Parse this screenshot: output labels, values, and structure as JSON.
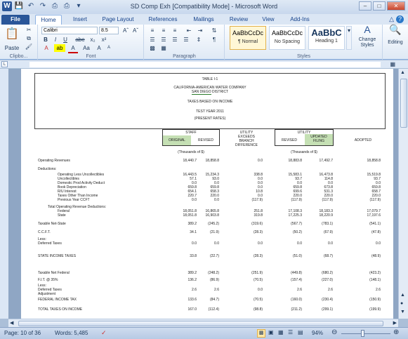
{
  "titlebar": {
    "title": "SD Comp Exh [Compatibility Mode] - Microsoft Word",
    "icons": [
      "word-logo-icon",
      "save-icon",
      "undo-icon",
      "redo-icon",
      "print-icon",
      "quick-print-icon",
      "customize-icon"
    ]
  },
  "tabs": [
    "File",
    "Home",
    "Insert",
    "Page Layout",
    "References",
    "Mailings",
    "Review",
    "View",
    "Add-Ins"
  ],
  "ribbon": {
    "clipboard": {
      "paste": "Paste",
      "label": "Clipbo..."
    },
    "font": {
      "name": "Calibri",
      "size": "8.5",
      "label": "Font",
      "buttons": [
        "B",
        "I",
        "U",
        "abe",
        "x₂",
        "x²",
        "A",
        "ab",
        "A",
        "Aa",
        "A",
        "A"
      ]
    },
    "paragraph": {
      "label": "Paragraph"
    },
    "styles": {
      "label": "Styles",
      "items": [
        {
          "preview": "AaBbCcDc",
          "name": "¶ Normal"
        },
        {
          "preview": "AaBbCcDc",
          "name": "No Spacing"
        },
        {
          "preview": "AaBbC",
          "name": "Heading 1"
        }
      ],
      "change": "Change Styles",
      "editing": "Editing"
    }
  },
  "doc": {
    "title1": "TABLE I-1",
    "title2": "CALIFORNIA-AMERICAN WATER COMPANY",
    "title2b": "SAN DIEGO",
    "title2c": " DISTRICT",
    "title3": "TAXES BASED ON INCOME",
    "title4": "TEST YEAR 2011",
    "title5": "(PRESENT RATES)",
    "hdr_staff": "STAFF",
    "hdr_original": "ORIGINAL",
    "hdr_revised": "REVISED",
    "hdr_utility_exceeds": "UTILITY\nEXCEEDS\nBRANCH\nDIFFERENCE",
    "hdr_utility": "UTILITY",
    "hdr_updated": "UPDATED\nFILING",
    "hdr_revised2": "REVISED",
    "hdr_adopted": "ADOPTED",
    "thousands1": "(Thousands of $)",
    "thousands2": "(Thousands of $)",
    "rows": [
      {
        "label": "Operating Revenues",
        "vals": [
          "18,440.7",
          "18,858.8",
          "0.0",
          "18,883.8",
          "17,492.7",
          "18,858.8"
        ],
        "indent": 0
      },
      {
        "label": "Deductions:",
        "vals": [],
        "indent": 0
      },
      {
        "label": "Operating Less Uncollectibles",
        "vals": [
          "16,443.5",
          "15,234.3",
          "338.8",
          "15,583.1",
          "16,473.8",
          "15,519.8"
        ],
        "indent": 2
      },
      {
        "label": "Uncollectibles",
        "vals": [
          "57.1",
          "93.0",
          "0.0",
          "93.7",
          "114.8",
          "93.7"
        ],
        "indent": 2
      },
      {
        "label": "Domestic Prod Activity Deduct",
        "vals": [
          "0.0",
          "0.0",
          "0.0",
          "0.0",
          "0.0",
          "0.0"
        ],
        "indent": 2
      },
      {
        "label": "Book Depreciation",
        "vals": [
          "659.8",
          "659.8",
          "0.0",
          "659.8",
          "673.8",
          "659.8"
        ],
        "indent": 2
      },
      {
        "label": "R/U Interest",
        "vals": [
          "654.1",
          "658.3",
          "10.8",
          "699.6",
          "531.3",
          "658.7"
        ],
        "indent": 2
      },
      {
        "label": "Taxes Other Than Income",
        "vals": [
          "220.7",
          "220.0",
          "0.0",
          "220.0",
          "220.0",
          "220.0"
        ],
        "indent": 2
      },
      {
        "label": "Previous Year CCFT",
        "vals": [
          "0.0",
          "0.0",
          "(117.9)",
          "(117.9)",
          "(117.9)",
          "(117.9)"
        ],
        "indent": 2
      },
      {
        "label": "Total Operating Revenue Deductions:",
        "vals": [],
        "indent": 1
      },
      {
        "label": "Federal",
        "vals": [
          "18,051.8",
          "16,865.8",
          "251.8",
          "17,108.3",
          "18,183.3",
          "17,079.7"
        ],
        "indent": 2
      },
      {
        "label": "State",
        "vals": [
          "18,051.8",
          "16,903.8",
          "319.8",
          "17,225.3",
          "18,220.9",
          "17,197.6"
        ],
        "indent": 2
      },
      {
        "label": "Taxable Net-State",
        "vals": [
          "389.2",
          "(245.2)",
          "(319.6)",
          "(567.7)",
          "(783.1)",
          "(541.1)"
        ],
        "indent": 0
      },
      {
        "label": "C.C.F.T.",
        "vals": [
          "34.1",
          "(21.9)",
          "(28.3)",
          "(50.2)",
          "(67.9)",
          "(47.8)"
        ],
        "indent": 0
      },
      {
        "label": "Less:",
        "vals": [],
        "indent": 0
      },
      {
        "label": "Deferred Taxes",
        "vals": [
          "0.0",
          "0.0",
          "0.0",
          "0.0",
          "0.0",
          "0.0"
        ],
        "indent": 0
      },
      {
        "label": "STATE INCOME TAXES",
        "vals": [
          "33.8",
          "(22.7)",
          "(28.3)",
          "(51.0)",
          "(68.7)",
          "(48.9)"
        ],
        "indent": 0
      },
      {
        "label": "Taxable Net Federal",
        "vals": [
          "389.2",
          "(248.2)",
          "(251.9)",
          "(449.8)",
          "(680.2)",
          "(423.2)"
        ],
        "indent": 0
      },
      {
        "label": "F.I.T. @ 35%",
        "vals": [
          "136.2",
          "(86.9)",
          "(70.5)",
          "(157.4)",
          "(227.0)",
          "(148.1)"
        ],
        "indent": 0
      },
      {
        "label": "Less:",
        "vals": [],
        "indent": 0
      },
      {
        "label": "Deferred Taxes",
        "vals": [
          "2.6",
          "2.6",
          "0.0",
          "2.6",
          "2.6",
          "2.6"
        ],
        "indent": 0
      },
      {
        "label": "Adjustment",
        "vals": [],
        "indent": 0
      },
      {
        "label": "FEDERAL INCOME TAX",
        "vals": [
          "133.6",
          "(84.7)",
          "(70.5)",
          "(160.0)",
          "(230.4)",
          "(150.9)"
        ],
        "indent": 0
      },
      {
        "label": "TOTAL TAXES ON INCOME",
        "vals": [
          "167.0",
          "(112.4)",
          "(98.8)",
          "(211.2)",
          "(299.1)",
          "(199.9)"
        ],
        "indent": 0
      }
    ]
  },
  "status": {
    "page": "Page: 10 of 36",
    "words": "Words: 5,485",
    "zoom": "94%"
  }
}
